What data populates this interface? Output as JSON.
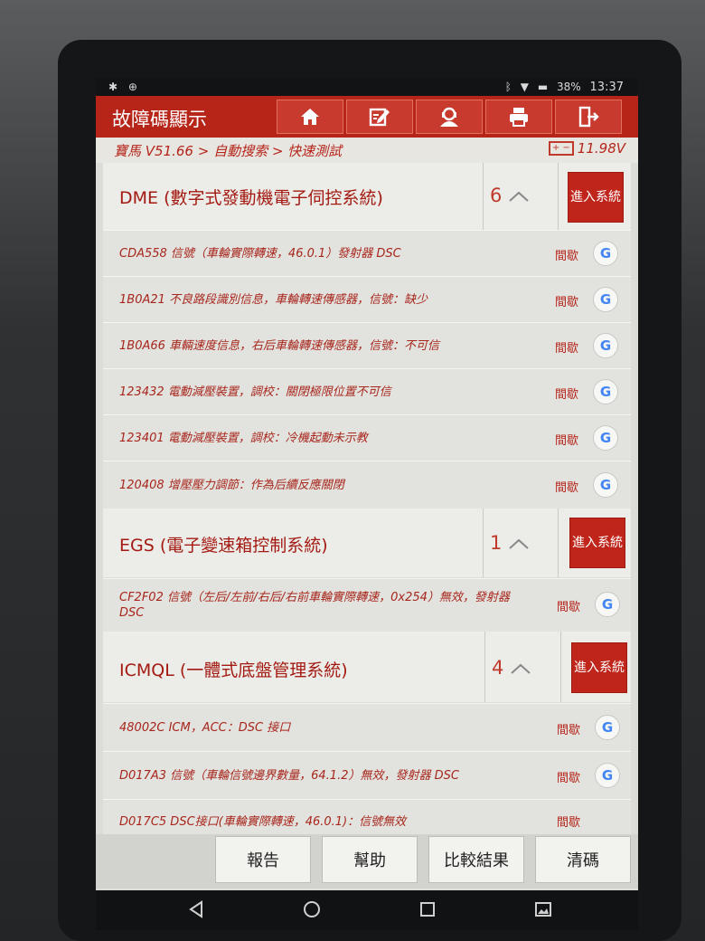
{
  "status_bar": {
    "left_icons": [
      "usb-debug-icon",
      "usb-icon"
    ],
    "battery": "38%",
    "time": "13:37"
  },
  "header": {
    "title": "故障碼顯示",
    "toolbar": [
      "home-icon",
      "edit-icon",
      "user-support-icon",
      "print-icon",
      "exit-icon"
    ]
  },
  "breadcrumb": "寶馬 V51.66 > 自動搜索 > 快速測試",
  "voltage": "11.98V",
  "enter_label": "進入系統",
  "systems": [
    {
      "name": "DME (數字式發動機電子伺控系統)",
      "count": "6",
      "codes": [
        {
          "text": "CDA558 信號（車輪實際轉速，46.0.1）發射器 DSC",
          "status": "間歇"
        },
        {
          "text": "1B0A21 不良路段識別信息，車輪轉速傳感器，信號：缺少",
          "status": "間歇"
        },
        {
          "text": "1B0A66 車輛速度信息，右后車輪轉速傳感器，信號：不可信",
          "status": "間歇"
        },
        {
          "text": "123432 電動減壓裝置，調校：關閉極限位置不可信",
          "status": "間歇"
        },
        {
          "text": "123401 電動減壓裝置，調校：冷機起動未示教",
          "status": "間歇"
        },
        {
          "text": "120408 增壓壓力調節：作為后續反應關閉",
          "status": "間歇"
        }
      ]
    },
    {
      "name": "EGS (電子變速箱控制系統)",
      "count": "1",
      "codes": [
        {
          "text": "CF2F02 信號（左后/左前/右后/右前車輪實際轉速，0x254）無效，發射器 DSC",
          "status": "間歇"
        }
      ]
    },
    {
      "name": "ICMQL (一體式底盤管理系統)",
      "count": "4",
      "codes": [
        {
          "text": "48002C ICM，ACC：DSC 接口",
          "status": "間歇"
        },
        {
          "text": "D017A3 信號（車輪信號邊界數量，64.1.2）無效，發射器 DSC",
          "status": "間歇"
        },
        {
          "text": "D017C5 DSC接口(車輪實際轉速，46.0.1)：信號無效",
          "status": "間歇"
        }
      ]
    }
  ],
  "bottom_buttons": [
    "報告",
    "幫助",
    "比較結果",
    "清碼"
  ],
  "colors": {
    "brand_red": "#b72418",
    "code_text": "#a8261c"
  }
}
